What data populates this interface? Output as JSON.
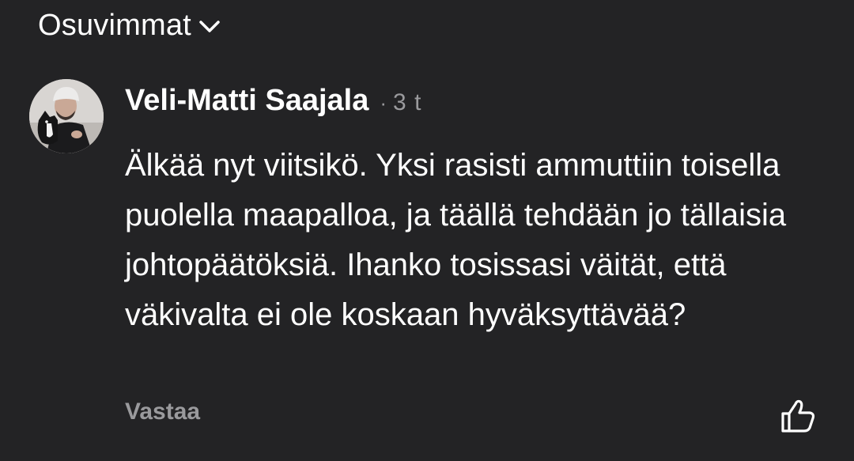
{
  "sort": {
    "label": "Osuvimmat",
    "icon": "chevron-down-icon"
  },
  "comment": {
    "author": "Veli-Matti Saajala",
    "separator": "·",
    "time": "3 t",
    "text": "Älkää nyt viitsikö. Yksi rasisti ammuttiin toisella puolella maapalloa, ja täällä tehdään jo tällaisia johtopäätöksiä. Ihanko tosissasi väität, että väkivalta ei ole koskaan hyväksyttävää?",
    "reply_label": "Vastaa",
    "like_icon": "thumbs-up-icon"
  },
  "colors": {
    "background": "#232325",
    "text_primary": "#ffffff",
    "text_secondary": "#9a9a9d"
  }
}
